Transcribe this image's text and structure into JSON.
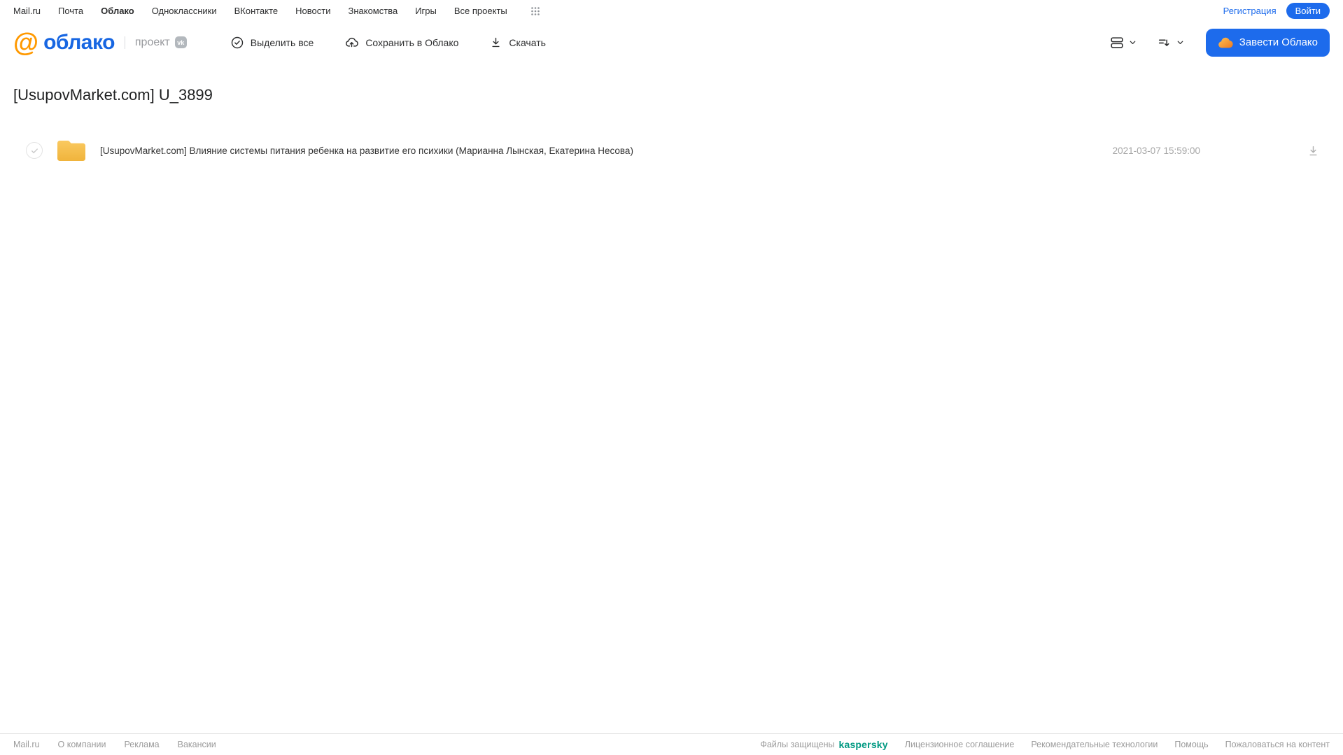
{
  "topbar": {
    "links": [
      {
        "label": "Mail.ru"
      },
      {
        "label": "Почта"
      },
      {
        "label": "Облако"
      },
      {
        "label": "Одноклассники"
      },
      {
        "label": "ВКонтакте"
      },
      {
        "label": "Новости"
      },
      {
        "label": "Знакомства"
      },
      {
        "label": "Игры"
      },
      {
        "label": "Все проекты"
      }
    ],
    "registration_label": "Регистрация",
    "login_label": "Войти"
  },
  "header": {
    "logo_at": "@",
    "logo_text": "облако",
    "project_label": "проект",
    "vk_badge": "vk",
    "toolbar": {
      "select_all_label": "Выделить все",
      "save_to_cloud_label": "Сохранить в Облако",
      "download_label": "Скачать"
    },
    "create_cloud_label": "Завести Облако"
  },
  "main": {
    "title": "[UsupovMarket.com] U_3899",
    "files": [
      {
        "type": "folder",
        "name": "[UsupovMarket.com] Влияние системы питания ребенка на развитие его психики (Марианна Лынская, Екатерина Несова)",
        "date": "2021-03-07 15:59:00"
      }
    ]
  },
  "footer": {
    "left_links": [
      {
        "label": "Mail.ru"
      },
      {
        "label": "О компании"
      },
      {
        "label": "Реклама"
      },
      {
        "label": "Вакансии"
      }
    ],
    "protected_label": "Файлы защищены",
    "kaspersky_label": "kaspersky",
    "right_links": [
      {
        "label": "Лицензионное соглашение"
      },
      {
        "label": "Рекомендательные технологии"
      },
      {
        "label": "Помощь"
      },
      {
        "label": "Пожаловаться на контент"
      }
    ]
  },
  "colors": {
    "accent_blue": "#1d6bec",
    "logo_orange": "#ff9900",
    "folder_yellow": "#f6bf4a",
    "kaspersky_green": "#009982",
    "text_dark": "#2c2d2e",
    "text_gray": "#9b9b9b"
  }
}
